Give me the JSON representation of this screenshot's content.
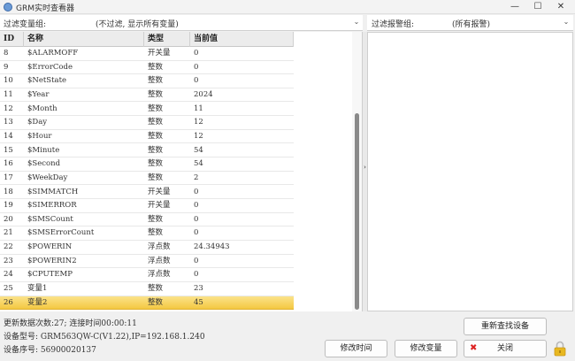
{
  "window": {
    "title": "GRM实时查看器",
    "controls": {
      "minimize": "—",
      "maximize": "☐",
      "close": "✕"
    }
  },
  "variable_filter": {
    "label": "过滤变量组:",
    "value": "(不过滤, 显示所有变量)",
    "caret": "⌄"
  },
  "alarm_filter": {
    "label": "过滤报警组:",
    "value": "(所有报警)",
    "caret": "⌄"
  },
  "table": {
    "columns": [
      "ID",
      "名称",
      "类型",
      "当前值"
    ],
    "rows": [
      {
        "id": "8",
        "name": "$ALARMOFF",
        "type": "开关量",
        "value": "0"
      },
      {
        "id": "9",
        "name": "$ErrorCode",
        "type": "整数",
        "value": "0"
      },
      {
        "id": "10",
        "name": "$NetState",
        "type": "整数",
        "value": "0"
      },
      {
        "id": "11",
        "name": "$Year",
        "type": "整数",
        "value": "2024"
      },
      {
        "id": "12",
        "name": "$Month",
        "type": "整数",
        "value": "11"
      },
      {
        "id": "13",
        "name": "$Day",
        "type": "整数",
        "value": "12"
      },
      {
        "id": "14",
        "name": "$Hour",
        "type": "整数",
        "value": "12"
      },
      {
        "id": "15",
        "name": "$Minute",
        "type": "整数",
        "value": "54"
      },
      {
        "id": "16",
        "name": "$Second",
        "type": "整数",
        "value": "54"
      },
      {
        "id": "17",
        "name": "$WeekDay",
        "type": "整数",
        "value": "2"
      },
      {
        "id": "18",
        "name": "$SIMMATCH",
        "type": "开关量",
        "value": "0"
      },
      {
        "id": "19",
        "name": "$SIMERROR",
        "type": "开关量",
        "value": "0"
      },
      {
        "id": "20",
        "name": "$SMSCount",
        "type": "整数",
        "value": "0"
      },
      {
        "id": "21",
        "name": "$SMSErrorCount",
        "type": "整数",
        "value": "0"
      },
      {
        "id": "22",
        "name": "$POWERIN",
        "type": "浮点数",
        "value": "24.34943"
      },
      {
        "id": "23",
        "name": "$POWERIN2",
        "type": "浮点数",
        "value": "0"
      },
      {
        "id": "24",
        "name": "$CPUTEMP",
        "type": "浮点数",
        "value": "0"
      },
      {
        "id": "25",
        "name": "变量1",
        "type": "整数",
        "value": "23"
      },
      {
        "id": "26",
        "name": "变量2",
        "type": "整数",
        "value": "45"
      }
    ],
    "selected_id": "26"
  },
  "splitter": {
    "arrow": "›"
  },
  "status": {
    "update_line": "更新数据次数:27; 连接时间00:00:11",
    "device_model": "设备型号: GRM563QW-C(V1.22),IP=192.168.1.240",
    "device_serial": "设备序号: 56900020137"
  },
  "buttons": {
    "rescan": "重新查找设备",
    "modify_time": "修改时间",
    "modify_variable": "修改变量",
    "close": "关闭",
    "close_icon": "✖"
  },
  "colors": {
    "selected_row": "#f4c842",
    "close_icon": "#dd2222",
    "lock": "#e8b820"
  }
}
